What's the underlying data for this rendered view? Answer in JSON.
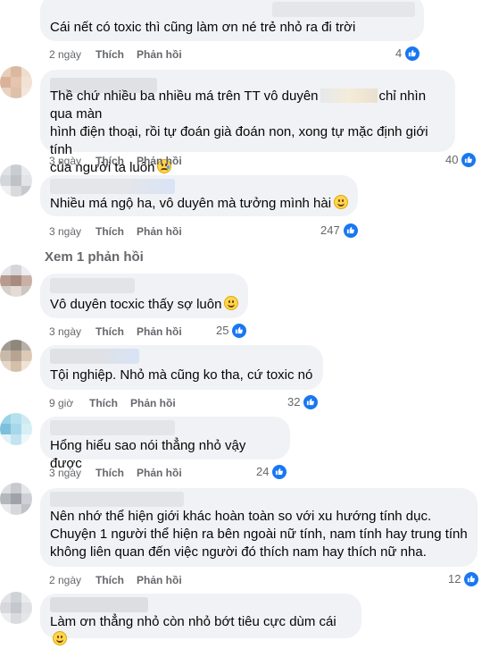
{
  "labels": {
    "like": "Thích",
    "reply": "Phản hồi",
    "view_replies": "Xem 1 phản hồi"
  },
  "colors": {
    "like_badge": "#1877f2",
    "bubble_bg": "#f0f2f5",
    "meta_text": "#65676b"
  },
  "comments": [
    {
      "text": "Cái nết có toxic thì cũng làm ơn né trẻ nhỏ ra đi trời",
      "time": "2 ngày",
      "reactions": "4",
      "emoji": ""
    },
    {
      "text_lines": [
        "Thề chứ nhiều ba nhiều má trên TT vô duyên",
        "hình điện thoại, rồi tự đoán già đoán non, xong tự mặc định giới tính",
        "của người ta luôn"
      ],
      "text_tail": "chỉ nhìn qua màn",
      "time": "3 ngày",
      "reactions": "40",
      "emoji": "sad-tear-emoji"
    },
    {
      "text": "Nhiều má ngộ ha, vô duyên mà tưởng mình hài",
      "time": "3 ngày",
      "reactions": "247",
      "emoji": "smile-emoji"
    },
    {
      "text": "Vô duyên tocxic thấy sợ luôn",
      "time": "3 ngày",
      "reactions": "25",
      "emoji": "smile-emoji"
    },
    {
      "text": "Tội nghiệp. Nhỏ mà cũng ko tha, cứ toxic nó",
      "time": "9 giờ",
      "reactions": "32",
      "emoji": ""
    },
    {
      "text": "Hổng hiểu sao nói thẳng nhỏ vậy được",
      "time": "3 ngày",
      "reactions": "24",
      "emoji": ""
    },
    {
      "text_lines": [
        "Nên nhớ thể hiện giới khác hoàn toàn so với xu hướng tính dục.",
        "Chuyện 1 người thể hiện ra bên ngoài nữ tính, nam tính hay trung tính",
        "không liên quan đến việc người đó thích nam hay thích nữ nha."
      ],
      "time": "2 ngày",
      "reactions": "12",
      "emoji": ""
    },
    {
      "text": "Làm ơn thẳng nhỏ còn nhỏ bớt tiêu cực dùm cái",
      "time": "",
      "reactions": "",
      "emoji": "smile-emoji"
    }
  ]
}
